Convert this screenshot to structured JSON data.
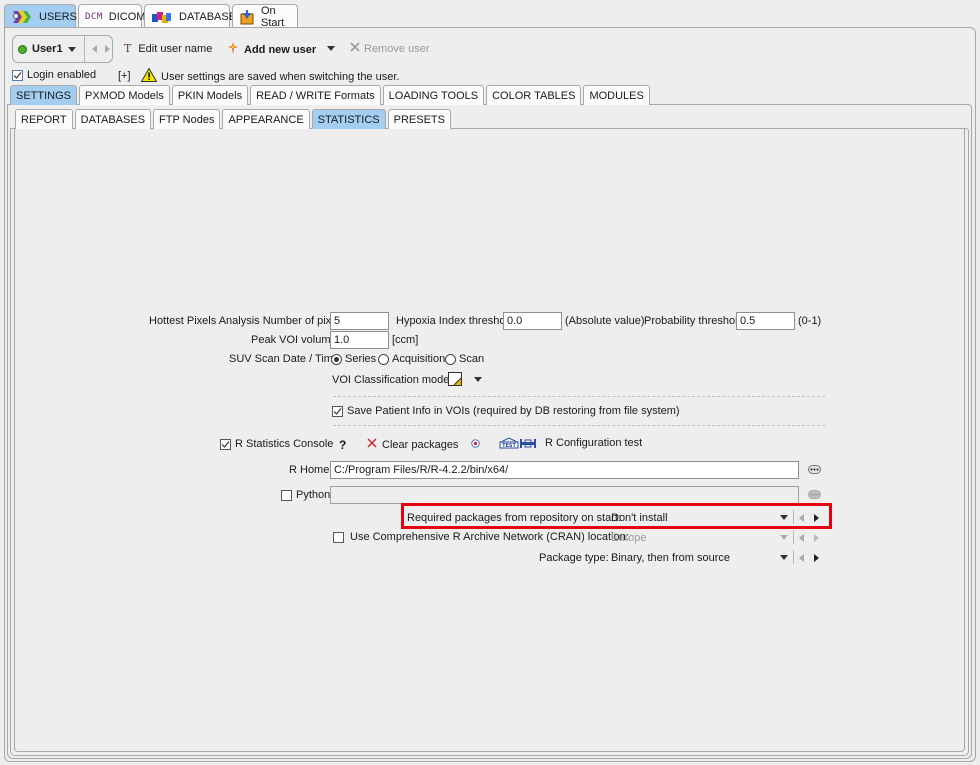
{
  "top_tabs": [
    {
      "label": "USERS",
      "icon": "users-icon",
      "active": true
    },
    {
      "label": "DICOM",
      "icon": "dcm-icon",
      "icon_text": "DCM",
      "active": false
    },
    {
      "label": "DATABASE",
      "icon": "database-icon",
      "active": false
    },
    {
      "label": "On Start",
      "icon": "on-start-icon",
      "active": false
    }
  ],
  "user_bar": {
    "current_user": "User1",
    "status_color": "#4caf28",
    "edit_user_name": "Edit user name",
    "add_new_user": "Add new user",
    "remove_user": "Remove user",
    "edit_icon_glyph": "T"
  },
  "login": {
    "label": "Login enabled",
    "checked": true,
    "expand": "[+]",
    "warning": "User settings are saved when switching the user."
  },
  "settings_tabs": [
    {
      "label": "SETTINGS",
      "active": true
    },
    {
      "label": "PXMOD Models",
      "active": false
    },
    {
      "label": "PKIN Models",
      "active": false
    },
    {
      "label": "READ / WRITE Formats",
      "active": false
    },
    {
      "label": "LOADING TOOLS",
      "active": false
    },
    {
      "label": "COLOR TABLES",
      "active": false
    },
    {
      "label": "MODULES",
      "active": false
    }
  ],
  "sub_tabs": [
    {
      "label": "REPORT",
      "active": false
    },
    {
      "label": "DATABASES",
      "active": false
    },
    {
      "label": "FTP Nodes",
      "active": false
    },
    {
      "label": "APPEARANCE",
      "active": false
    },
    {
      "label": "STATISTICS",
      "active": true
    },
    {
      "label": "PRESETS",
      "active": false
    }
  ],
  "statistics": {
    "hottest_pixels_label": "Hottest Pixels Analysis Number of pixels",
    "hottest_pixels_value": "5",
    "hypoxia_label": "Hypoxia Index threshold",
    "hypoxia_value": "0.0",
    "hypoxia_unit": "(Absolute value)",
    "probability_label": "Probability threshold",
    "probability_value": "0.5",
    "probability_unit": "(0-1)",
    "peak_voi_label": "Peak VOI volume",
    "peak_voi_value": "1.0",
    "peak_voi_unit": "[ccm]",
    "suv_label": "SUV Scan Date / Time",
    "suv_options": [
      "Series",
      "Acquisition",
      "Scan"
    ],
    "suv_selected": "Series",
    "voi_class_label": "VOI Classification mode:",
    "save_patient_label": "Save Patient Info in VOIs (required by DB restoring from file system)",
    "save_patient_checked": true
  },
  "r_console": {
    "label": "R Statistics Console",
    "checked": true,
    "help": "?",
    "clear_packages": "Clear packages",
    "config_test": "R Configuration test",
    "test_icon_text": "TEST",
    "r_home_label": "R Home",
    "r_home_value": "C:/Program Files/R/R-4.2.2/bin/x64/",
    "python_label": "Python",
    "python_checked": false,
    "python_value": "",
    "required_packages_label": "Required packages from repository on start:",
    "required_packages_value": "Don't install",
    "cran_label": "Use Comprehensive R Archive Network (CRAN) location:",
    "cran_checked": false,
    "cran_value": "Europe",
    "package_type_label": "Package type:",
    "package_type_value": "Binary, then from source"
  },
  "highlight_color": "#e8000f"
}
